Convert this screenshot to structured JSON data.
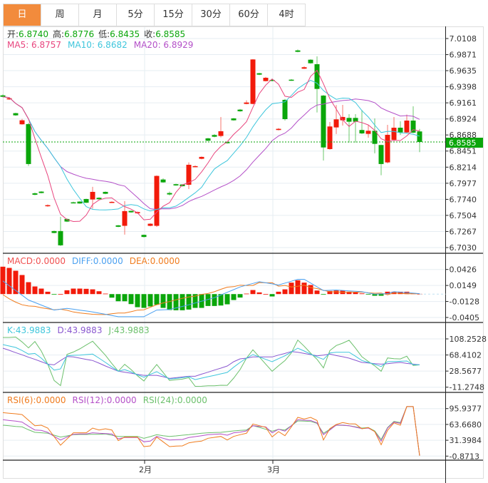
{
  "tabs": [
    {
      "label": "日",
      "active": true
    },
    {
      "label": "周"
    },
    {
      "label": "月"
    },
    {
      "label": "5分"
    },
    {
      "label": "15分"
    },
    {
      "label": "30分"
    },
    {
      "label": "60分"
    },
    {
      "label": "4时"
    }
  ],
  "colors": {
    "up": "#f21a0a",
    "down": "#0aa60a",
    "ma5": "#e8457e",
    "ma10": "#3ec6dc",
    "ma20": "#b450c8",
    "diff": "#4aa0f0",
    "dea": "#f07c1e",
    "k": "#3ec6dc",
    "d": "#8a58d0",
    "j": "#6cc06c",
    "rsi6": "#f07c1e",
    "rsi12": "#b450c8",
    "rsi24": "#6cc06c"
  },
  "ohlc_legend": {
    "open_label": "开:",
    "open": "6.8740",
    "high_label": "高:",
    "high": "6.8776",
    "low_label": "低:",
    "low": "6.8435",
    "close_label": "收:",
    "close": "6.8585"
  },
  "ma_legend": {
    "ma5": "MA5: 6.8757",
    "ma10": "MA10: 6.8682",
    "ma20": "MA20: 6.8929"
  },
  "macd_legend": {
    "macd": "MACD:0.0000",
    "diff": "DIFF:0.0000",
    "dea": "DEA:0.0000"
  },
  "kdj_legend": {
    "k": "K:43.9883",
    "d": "D:43.9883",
    "j": "J:43.9883"
  },
  "rsi_legend": {
    "rsi6": "RSI(6):0.0000",
    "rsi12": "RSI(12):0.0000",
    "rsi24": "RSI(24):0.0000"
  },
  "current_price": "6.8585",
  "chart_data": [
    {
      "type": "candlestick",
      "panel": "price",
      "y_ticks": [
        "7.0108",
        "6.9871",
        "6.9635",
        "6.9398",
        "6.9161",
        "6.8924",
        "6.8688",
        "6.8451",
        "6.8214",
        "6.7977",
        "6.7740",
        "6.7504",
        "6.7267",
        "6.7030"
      ],
      "ylim": [
        6.703,
        7.0108
      ],
      "x_labels": [
        {
          "index": 22,
          "label": "2月"
        },
        {
          "index": 42,
          "label": "3月"
        }
      ],
      "ohlc": [
        [
          6.9271,
          6.9284,
          6.9242,
          6.925
        ],
        [
          6.9212,
          6.9235,
          6.9205,
          6.9229
        ],
        [
          6.9009,
          6.9015,
          6.897,
          6.8977
        ],
        [
          6.8845,
          6.8925,
          6.884,
          6.8904
        ],
        [
          6.8848,
          6.8869,
          6.8232,
          6.826
        ],
        [
          6.7829,
          6.784,
          6.78,
          6.7808
        ],
        [
          6.7854,
          6.786,
          6.7828,
          6.7833
        ],
        [
          6.7648,
          6.7665,
          6.763,
          6.7654
        ],
        [
          6.7273,
          6.728,
          6.724,
          6.7245
        ],
        [
          6.7273,
          6.7483,
          6.7053,
          6.7063
        ],
        [
          6.7451,
          6.746,
          6.7405,
          6.7413
        ],
        [
          6.7696,
          6.7705,
          6.7682,
          6.769
        ],
        [
          6.7707,
          6.7712,
          6.7675,
          6.7679
        ],
        [
          6.7745,
          6.775,
          6.7685,
          6.769
        ],
        [
          6.7738,
          6.7924,
          6.7602,
          6.785
        ],
        [
          6.7763,
          6.777,
          6.7736,
          6.7742
        ],
        [
          6.785,
          6.7856,
          6.7816,
          6.7822
        ],
        [
          6.7696,
          6.7712,
          6.7688,
          6.7703
        ],
        [
          6.7357,
          6.7362,
          6.733,
          6.7336
        ],
        [
          6.735,
          6.7714,
          6.722,
          6.7567
        ],
        [
          6.757,
          6.7576,
          6.7544,
          6.7549
        ],
        [
          6.7535,
          6.756,
          6.7528,
          6.7553
        ],
        [
          6.7217,
          6.7222,
          6.718,
          6.7186
        ],
        [
          6.735,
          6.7388,
          6.7344,
          6.7381
        ],
        [
          6.735,
          6.8092,
          6.7333,
          6.8085
        ],
        [
          6.8032,
          6.805,
          6.7985,
          6.799
        ],
        [
          6.7833,
          6.7854,
          6.7798,
          6.7812
        ],
        [
          6.7963,
          6.797,
          6.794,
          6.7945
        ],
        [
          6.7959,
          6.7965,
          6.7928,
          6.7934
        ],
        [
          6.7955,
          6.8284,
          6.7892,
          6.8249
        ],
        [
          6.8222,
          6.824,
          6.8215,
          6.8229
        ],
        [
          6.8337,
          6.8372,
          6.833,
          6.8365
        ],
        [
          6.8638,
          6.8645,
          6.8598,
          6.8603
        ],
        [
          6.8687,
          6.87,
          6.8655,
          6.8662
        ],
        [
          6.8673,
          6.8953,
          6.8652,
          6.8743
        ],
        [
          6.8582,
          6.859,
          6.8563,
          6.8568
        ],
        [
          6.8932,
          6.8938,
          6.8898,
          6.8904
        ],
        [
          6.9061,
          6.907,
          6.903,
          6.9037
        ],
        [
          6.9145,
          6.9198,
          6.914,
          6.9166
        ],
        [
          6.9145,
          6.9805,
          6.914,
          6.98
        ],
        [
          6.9597,
          6.9603,
          6.957,
          6.9576
        ],
        [
          6.9481,
          6.9544,
          6.9476,
          6.953
        ],
        [
          6.9499,
          6.9513,
          6.9478,
          6.9488
        ],
        [
          6.8761,
          6.879,
          6.8755,
          6.8778
        ],
        [
          6.9205,
          6.9219,
          6.89,
          6.8921
        ],
        [
          6.9502,
          6.951,
          6.9485,
          6.9492
        ],
        [
          6.9933,
          6.9947,
          6.9906,
          6.9912
        ],
        [
          6.9664,
          6.9699,
          6.966,
          6.9685
        ],
        [
          6.9796,
          6.9802,
          6.9738,
          6.9744
        ],
        [
          6.973,
          6.9845,
          6.9019,
          6.9366
        ],
        [
          6.9268,
          6.9275,
          6.8312,
          6.8504
        ],
        [
          6.848,
          6.8879,
          6.847,
          6.8813
        ],
        [
          6.8799,
          6.9128,
          6.8701,
          6.8918
        ],
        [
          6.8904,
          6.9131,
          6.8827,
          6.8953
        ],
        [
          6.8939,
          6.8995,
          6.8575,
          6.8883
        ],
        [
          6.8939,
          6.8995,
          6.8575,
          6.8883
        ],
        [
          6.8761,
          6.9058,
          6.8701,
          6.8711
        ],
        [
          6.8704,
          6.8837,
          6.8648,
          6.875
        ],
        [
          6.875,
          6.8932,
          6.8417,
          6.8557
        ],
        [
          6.854,
          6.8545,
          6.8095,
          6.826
        ],
        [
          6.8284,
          6.8837,
          6.827,
          6.869
        ],
        [
          6.8617,
          6.8953,
          6.8596,
          6.8795
        ],
        [
          6.8795,
          6.889,
          6.869,
          6.8725
        ],
        [
          6.8725,
          6.8988,
          6.8715,
          6.89
        ],
        [
          6.89,
          6.911,
          6.8715,
          6.8722
        ],
        [
          6.874,
          6.8776,
          6.8435,
          6.8585
        ]
      ],
      "ma_periods": [
        5,
        10,
        20
      ]
    },
    {
      "type": "bar+line",
      "panel": "macd",
      "y_ticks": [
        "0.0426",
        "0.0149",
        "-0.0128",
        "-0.0405"
      ],
      "ylim": [
        -0.0405,
        0.0426
      ],
      "macd": [
        0.0474,
        0.0453,
        0.0404,
        0.033,
        0.0206,
        0.0132,
        0.0095,
        0.0041,
        -0.0008,
        0.0,
        0.0066,
        0.0095,
        0.0095,
        0.0091,
        0.0082,
        0.0049,
        0.0008,
        -0.0062,
        -0.0124,
        -0.0124,
        -0.0173,
        -0.0227,
        -0.0239,
        -0.0214,
        -0.0185,
        -0.0239,
        -0.0276,
        -0.028,
        -0.028,
        -0.0268,
        -0.0239,
        -0.0239,
        -0.0206,
        -0.0206,
        -0.0198,
        -0.0177,
        -0.0103,
        -0.006,
        0.0008,
        0.007,
        0.0029,
        0.0,
        -0.0041,
        0.0041,
        0.0082,
        0.0198,
        0.0239,
        0.0198,
        0.0157,
        0.0062,
        -0.0008,
        0.0054,
        0.0062,
        0.0062,
        0.0041,
        0.0029,
        0.0012,
        -0.0004,
        -0.0029,
        -0.0029,
        0.0041,
        0.0041,
        0.0041,
        0.0041,
        0.0016,
        0.0004
      ],
      "diff": [
        0.0227,
        0.0145,
        0.0063,
        -0.002,
        -0.0103,
        -0.0146,
        -0.019,
        -0.0233,
        -0.0276,
        -0.0262,
        -0.0247,
        -0.0262,
        -0.0278,
        -0.0293,
        -0.0309,
        -0.033,
        -0.035,
        -0.0371,
        -0.0391,
        -0.0391,
        -0.0391,
        -0.0391,
        -0.0391,
        -0.0334,
        -0.0276,
        -0.0272,
        -0.0268,
        -0.024,
        -0.0213,
        -0.0185,
        -0.0154,
        -0.0124,
        -0.0093,
        -0.0062,
        -0.0016,
        0.0031,
        0.0077,
        0.0124,
        0.0154,
        0.0184,
        0.0214,
        0.0195,
        0.0176,
        0.0157,
        0.019,
        0.0222,
        0.0255,
        0.0255,
        0.0191,
        0.0126,
        0.0062,
        0.0066,
        0.007,
        0.0063,
        0.0056,
        0.0048,
        0.0041,
        0.002,
        0.0,
        0.0004,
        0.0008,
        0.0041,
        0.0033,
        0.0025,
        0.0016,
        0.0008
      ]
    },
    {
      "type": "line",
      "panel": "kdj",
      "y_ticks": [
        "108.2528",
        "68.4102",
        "28.5677",
        "-11.2748"
      ],
      "ylim": [
        -11.2748,
        108.2528
      ],
      "k": [
        94.1,
        90.6,
        87.0,
        79.4,
        70.6,
        72.3,
        60.5,
        45.8,
        31.1,
        34.0,
        66.4,
        67.6,
        68.2,
        69.4,
        70.6,
        60.5,
        50.0,
        38.8,
        28.2,
        32.3,
        26.4,
        19.3,
        13.4,
        20.5,
        27.0,
        18.1,
        8.7,
        10.5,
        12.2,
        14.6,
        7.5,
        11.1,
        14.6,
        18.1,
        21.7,
        25.2,
        38.2,
        50.0,
        60.5,
        69.4,
        63.5,
        57.6,
        51.7,
        59.4,
        66.4,
        75.9,
        85.3,
        78.2,
        70.6,
        63.5,
        57.6,
        73.5,
        75.3,
        75.3,
        75.3,
        65.3,
        54.7,
        50.0,
        45.2,
        39.9,
        51.7,
        52.3,
        52.9,
        53.5,
        44.6,
        43.9883
      ],
      "d": [
        85.3,
        80.0,
        74.1,
        68.8,
        62.9,
        57.6,
        51.7,
        45.8,
        44.0,
        54.7,
        64.7,
        63.5,
        60.5,
        57.6,
        54.7,
        48.2,
        41.1,
        34.6,
        28.2,
        25.8,
        23.4,
        20.5,
        18.1,
        18.1,
        18.1,
        14.6,
        10.5,
        12.2,
        14.0,
        15.8,
        15.8,
        21.1,
        25.8,
        31.1,
        35.8,
        41.1,
        51.7,
        58.8,
        60.5,
        63.5,
        63.5,
        63.5,
        63.5,
        68.2,
        72.3,
        77.0,
        75.3,
        72.3,
        69.4,
        66.4,
        68.2,
        70.6,
        67.0,
        64.1,
        60.5,
        55.2,
        50.0,
        48.8,
        47.0,
        45.8,
        47.0,
        48.8,
        50.0,
        47.6,
        45.8,
        43.9883
      ]
    },
    {
      "type": "line",
      "panel": "rsi",
      "y_ticks": [
        "95.9377",
        "63.6680",
        "31.3984",
        "-0.8713"
      ],
      "ylim": [
        -0.8713,
        95.9377
      ],
      "rsi6": [
        87.7,
        86.3,
        85.3,
        83.8,
        72.2,
        61.1,
        62.0,
        56.3,
        38.8,
        21.4,
        34.0,
        46.6,
        46.6,
        46.6,
        56.3,
        52.4,
        54.8,
        52.4,
        30.6,
        37.9,
        37.9,
        37.9,
        18.5,
        19.9,
        37.9,
        28.2,
        18.5,
        19.5,
        19.9,
        26.2,
        28.2,
        29.6,
        35.4,
        37.4,
        39.3,
        32.0,
        39.3,
        42.7,
        45.6,
        64.5,
        61.1,
        57.7,
        38.3,
        49.0,
        40.7,
        58.7,
        78.0,
        74.6,
        78.0,
        71.7,
        32.0,
        55.3,
        63.5,
        67.4,
        65.0,
        64.5,
        54.8,
        57.2,
        49.0,
        22.4,
        51.4,
        66.9,
        62.0,
        100,
        100,
        0
      ],
      "rsi12": [
        73.2,
        71.7,
        70.3,
        68.4,
        60.1,
        52.4,
        51.4,
        47.5,
        39.3,
        32.0,
        37.9,
        43.6,
        44.2,
        44.2,
        46.6,
        45.6,
        45.1,
        44.2,
        34.5,
        36.9,
        36.9,
        36.9,
        28.2,
        29.6,
        39.3,
        35.4,
        32.0,
        32.5,
        33.0,
        36.9,
        38.8,
        40.7,
        42.7,
        43.6,
        44.2,
        41.7,
        46.6,
        48.0,
        50.4,
        61.1,
        59.6,
        58.7,
        46.6,
        53.8,
        50.0,
        61.1,
        73.2,
        72.2,
        71.7,
        66.9,
        42.7,
        52.4,
        62.5,
        62.0,
        61.1,
        58.2,
        55.3,
        56.3,
        49.0,
        29.6,
        56.3,
        68.4,
        65.9,
        100,
        100,
        0
      ],
      "rsi24": [
        62.0,
        61.1,
        59.6,
        58.7,
        52.8,
        47.5,
        46.6,
        45.6,
        41.7,
        37.9,
        40.3,
        42.7,
        43.2,
        43.2,
        43.6,
        43.6,
        44.2,
        41.7,
        39.3,
        39.3,
        39.3,
        39.3,
        35.4,
        38.8,
        42.7,
        40.7,
        39.3,
        40.3,
        41.7,
        42.7,
        44.2,
        45.6,
        46.6,
        47.1,
        47.5,
        49.0,
        50.4,
        51.4,
        52.4,
        61.1,
        57.7,
        53.8,
        50.0,
        53.8,
        52.4,
        61.1,
        70.8,
        70.3,
        69.8,
        65.9,
        45.6,
        53.8,
        62.0,
        61.6,
        61.1,
        58.7,
        56.3,
        57.2,
        50.4,
        33.0,
        57.2,
        69.8,
        67.4,
        100,
        100,
        0
      ]
    }
  ]
}
